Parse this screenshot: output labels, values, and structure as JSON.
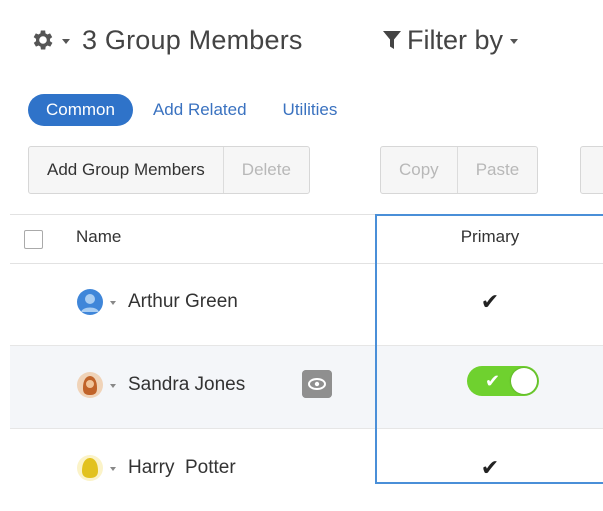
{
  "header": {
    "settings_icon": "gear-icon",
    "title": "3 Group Members",
    "filter_icon": "funnel-icon",
    "filter_label": "Filter by"
  },
  "tabs": [
    {
      "label": "Common",
      "active": true
    },
    {
      "label": "Add Related",
      "active": false
    },
    {
      "label": "Utilities",
      "active": false
    }
  ],
  "toolbar": {
    "add_group_members": "Add Group Members",
    "delete": "Delete",
    "copy": "Copy",
    "paste": "Paste"
  },
  "table": {
    "columns": {
      "name": "Name",
      "primary": "Primary"
    },
    "rows": [
      {
        "name": "Arthur Green",
        "avatar_color": "#3f86d9",
        "primary": "✔",
        "primary_style": "check"
      },
      {
        "name": "Sandra Jones",
        "avatar_color": "#c0632a",
        "primary": "✔",
        "primary_style": "toggle-on"
      },
      {
        "name": "Harry  Potter",
        "avatar_color": "#e2c21e",
        "primary": "✔",
        "primary_style": "check"
      }
    ]
  },
  "colors": {
    "accent": "#2f73c9",
    "toggle_on": "#6fd12f",
    "selection_outline": "#4a8fd8"
  }
}
